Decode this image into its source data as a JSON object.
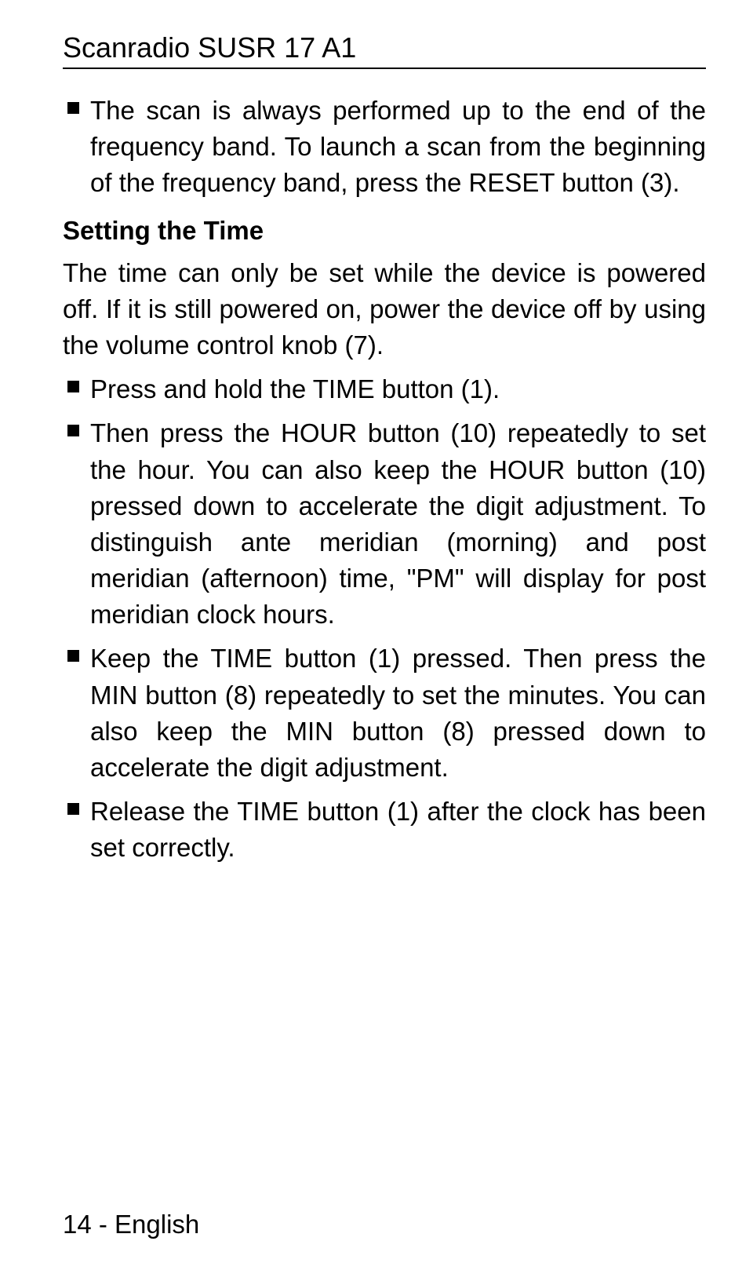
{
  "header": {
    "title": "Scanradio SUSR 17 A1"
  },
  "bullets": {
    "b1": "The scan is always performed up to the end of the frequency band. To launch a scan from the beginning of the frequency band, press the RESET button (3).",
    "b2": "Press and hold the TIME button (1).",
    "b3": "Then press the HOUR button (10) repeatedly to set the hour. You can also keep the HOUR button (10) pressed down to accelerate the digit adjustment. To distinguish ante meridian (morning) and post meridian (afternoon) time, \"PM\" will display for post meridian clock hours.",
    "b4": "Keep the TIME button (1) pressed. Then press the MIN button (8) repeatedly to set the minutes. You can also keep the MIN button (8) pressed down to accelerate the digit adjustment.",
    "b5": "Release the TIME button (1) after the clock has been set correctly."
  },
  "subheading": {
    "setting_time": "Setting the Time"
  },
  "body": {
    "setting_time_intro": "The time can only be set while the device is powered off. If it is still powered on, power the device off by using the volume control knob (7)."
  },
  "footer": {
    "page_label": "14  -  English"
  }
}
